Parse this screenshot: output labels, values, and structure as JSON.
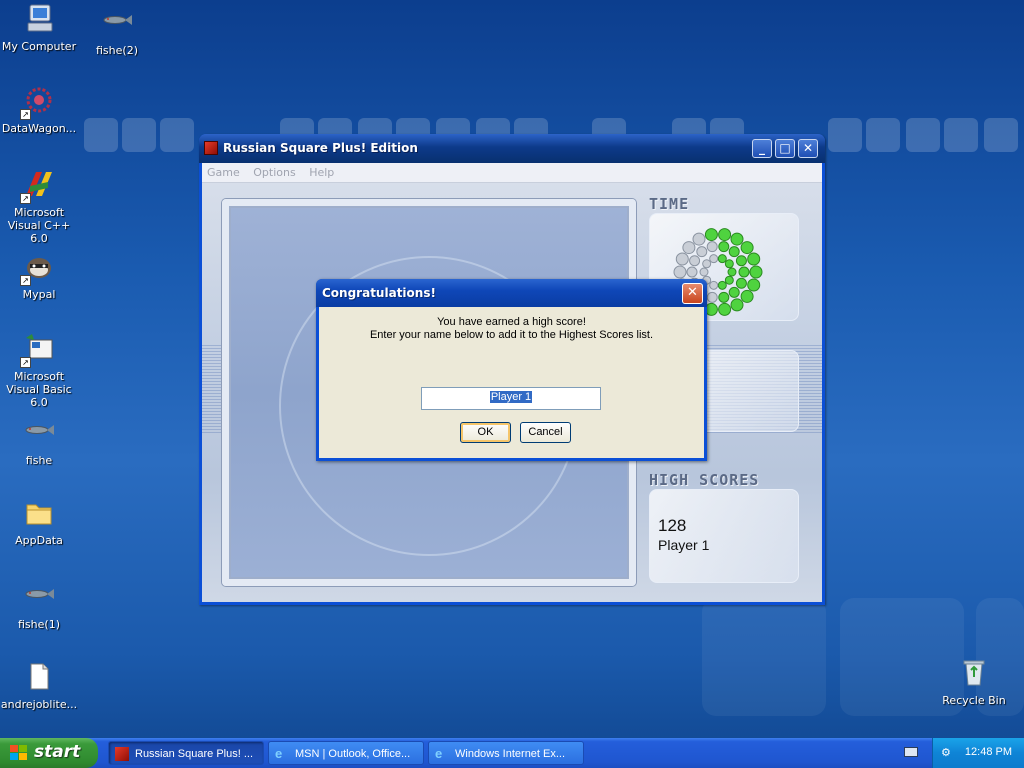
{
  "desktop": {
    "icons": [
      {
        "label": "My Computer",
        "icon": "computer-icon"
      },
      {
        "label": "fishe(2)",
        "icon": "fish-icon"
      },
      {
        "label": "DataWagon...",
        "icon": "datawagon-icon"
      },
      {
        "label": "Microsoft Visual C++ 6.0",
        "icon": "visual-cpp-icon"
      },
      {
        "label": "Mypal",
        "icon": "mypal-raccoon-icon"
      },
      {
        "label": "Microsoft Visual Basic 6.0",
        "icon": "visual-basic-icon"
      },
      {
        "label": "fishe",
        "icon": "fish-icon"
      },
      {
        "label": "AppData",
        "icon": "folder-icon"
      },
      {
        "label": "fishe(1)",
        "icon": "fish-icon"
      },
      {
        "label": "andrejoblite...",
        "icon": "document-icon"
      },
      {
        "label": "Recycle Bin",
        "icon": "recycle-bin-icon"
      }
    ]
  },
  "game_window": {
    "title": "Russian Square Plus! Edition",
    "menu": [
      "Game",
      "Options",
      "Help"
    ],
    "panels": {
      "time_label": "TIME",
      "high_scores_label": "HIGH SCORES",
      "high_score_value": "128",
      "high_score_name": "Player 1"
    }
  },
  "dialog": {
    "title": "Congratulations!",
    "message_line1": "You have earned a high score!",
    "message_line2": "Enter your name below to add it to the Highest Scores list.",
    "name_value": "Player 1",
    "ok_label": "OK",
    "cancel_label": "Cancel"
  },
  "taskbar": {
    "start_label": "start",
    "tasks": [
      {
        "label": "Russian Square Plus! ...",
        "active": true
      },
      {
        "label": "MSN | Outlook, Office...",
        "active": false
      },
      {
        "label": "Windows Internet Ex...",
        "active": false
      }
    ],
    "clock": "12:48 PM"
  },
  "colors": {
    "xp_blue": "#0b4fd6",
    "start_green": "#3a9a3a",
    "selection_blue": "#316ac5"
  }
}
